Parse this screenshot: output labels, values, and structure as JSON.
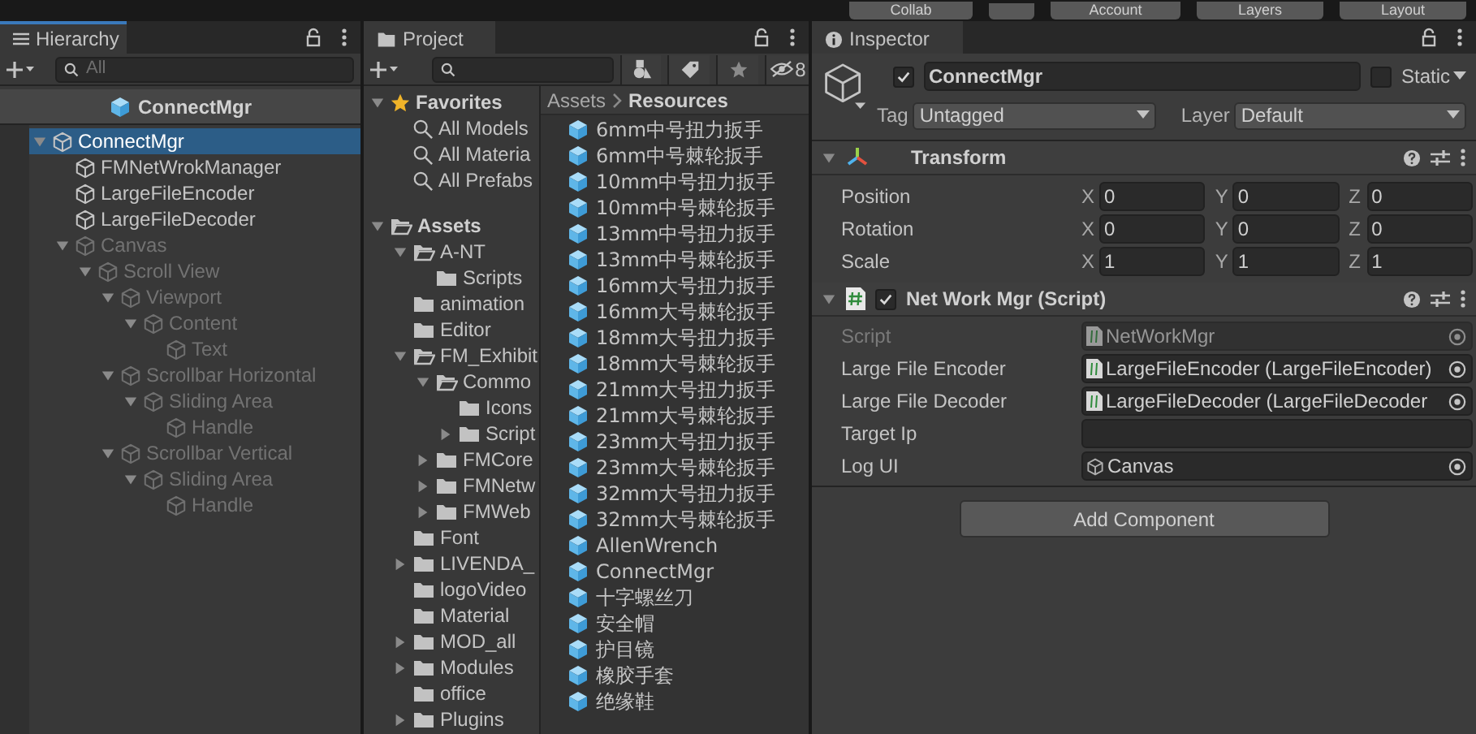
{
  "toolbar": {
    "buttons": [
      "Collab",
      "Account",
      "Layers",
      "Layout"
    ]
  },
  "hierarchy": {
    "tab": {
      "title": "Hierarchy",
      "focused": true
    },
    "search": {
      "placeholder": "All"
    },
    "scene_header": "ConnectMgr",
    "tree": [
      {
        "label": "ConnectMgr",
        "selected": true,
        "active": true,
        "expanded": true,
        "children": [
          {
            "label": "FMNetWrokManager",
            "selected": false,
            "active": true
          },
          {
            "label": "LargeFileEncoder",
            "selected": false,
            "active": true
          },
          {
            "label": "LargeFileDecoder",
            "selected": false,
            "active": true
          },
          {
            "label": "Canvas",
            "selected": false,
            "active": false,
            "expanded": true,
            "children": [
              {
                "label": "Scroll View",
                "selected": false,
                "active": false,
                "expanded": true,
                "children": [
                  {
                    "label": "Viewport",
                    "selected": false,
                    "active": false,
                    "expanded": true,
                    "children": [
                      {
                        "label": "Content",
                        "selected": false,
                        "active": false,
                        "expanded": true,
                        "children": [
                          {
                            "label": "Text",
                            "selected": false,
                            "active": false
                          }
                        ]
                      }
                    ]
                  },
                  {
                    "label": "Scrollbar Horizontal",
                    "selected": false,
                    "active": false,
                    "expanded": true,
                    "children": [
                      {
                        "label": "Sliding Area",
                        "selected": false,
                        "active": false,
                        "expanded": true,
                        "children": [
                          {
                            "label": "Handle",
                            "selected": false,
                            "active": false
                          }
                        ]
                      }
                    ]
                  },
                  {
                    "label": "Scrollbar Vertical",
                    "selected": false,
                    "active": false,
                    "expanded": true,
                    "children": [
                      {
                        "label": "Sliding Area",
                        "selected": false,
                        "active": false,
                        "expanded": true,
                        "children": [
                          {
                            "label": "Handle",
                            "selected": false,
                            "active": false
                          }
                        ]
                      }
                    ]
                  }
                ]
              }
            ]
          }
        ]
      }
    ]
  },
  "project": {
    "tab": {
      "title": "Project",
      "focused": false
    },
    "hidden_count": "8",
    "favorites": {
      "label": "Favorites",
      "expanded": true,
      "items": [
        "All Models",
        "All Materia",
        "All Prefabs"
      ]
    },
    "assets": {
      "label": "Assets",
      "expanded": true,
      "children": [
        {
          "label": "A-NT",
          "expanded": true,
          "children": [
            {
              "label": "Scripts"
            }
          ]
        },
        {
          "label": "animation"
        },
        {
          "label": "Editor"
        },
        {
          "label": "FM_Exhibit",
          "expanded": true,
          "children": [
            {
              "label": "Commo",
              "expanded": true,
              "children": [
                {
                  "label": "Icons"
                },
                {
                  "label": "Script",
                  "expanded": false
                }
              ]
            },
            {
              "label": "FMCore",
              "expanded": false
            },
            {
              "label": "FMNetw",
              "expanded": false
            },
            {
              "label": "FMWeb",
              "expanded": false
            }
          ]
        },
        {
          "label": "Font"
        },
        {
          "label": "LIVENDA_",
          "expanded": false
        },
        {
          "label": "logoVideo"
        },
        {
          "label": "Material"
        },
        {
          "label": "MOD_all",
          "expanded": false
        },
        {
          "label": "Modules",
          "expanded": false
        },
        {
          "label": "office"
        },
        {
          "label": "Plugins",
          "expanded": false
        }
      ]
    },
    "breadcrumb": [
      "Assets",
      "Resources"
    ],
    "files": [
      "6mm中号扭力扳手",
      "6mm中号棘轮扳手",
      "10mm中号扭力扳手",
      "10mm中号棘轮扳手",
      "13mm中号扭力扳手",
      "13mm中号棘轮扳手",
      "16mm大号扭力扳手",
      "16mm大号棘轮扳手",
      "18mm大号扭力扳手",
      "18mm大号棘轮扳手",
      "21mm大号扭力扳手",
      "21mm大号棘轮扳手",
      "23mm大号扭力扳手",
      "23mm大号棘轮扳手",
      "32mm大号扭力扳手",
      "32mm大号棘轮扳手",
      "AllenWrench",
      "ConnectMgr",
      "十字螺丝刀",
      "安全帽",
      "护目镜",
      "橡胶手套",
      "绝缘鞋"
    ]
  },
  "inspector": {
    "tab": {
      "title": "Inspector",
      "focused": false
    },
    "object": {
      "enabled": true,
      "name": "ConnectMgr",
      "static": false,
      "static_label": "Static",
      "tag_label": "Tag",
      "tag": "Untagged",
      "layer_label": "Layer",
      "layer": "Default"
    },
    "transform": {
      "title": "Transform",
      "expanded": true,
      "rows": [
        {
          "label": "Position",
          "values": [
            {
              "axis": "X",
              "value": "0"
            },
            {
              "axis": "Y",
              "value": "0"
            },
            {
              "axis": "Z",
              "value": "0"
            }
          ]
        },
        {
          "label": "Rotation",
          "values": [
            {
              "axis": "X",
              "value": "0"
            },
            {
              "axis": "Y",
              "value": "0"
            },
            {
              "axis": "Z",
              "value": "0"
            }
          ]
        },
        {
          "label": "Scale",
          "values": [
            {
              "axis": "X",
              "value": "1"
            },
            {
              "axis": "Y",
              "value": "1"
            },
            {
              "axis": "Z",
              "value": "1"
            }
          ]
        }
      ]
    },
    "script_component": {
      "title": "Net Work Mgr (Script)",
      "expanded": true,
      "enabled": true,
      "fields": [
        {
          "label": "Script",
          "kind": "script",
          "value": "NetWorkMgr",
          "disabled": true
        },
        {
          "label": "Large File Encoder",
          "kind": "script",
          "value": "LargeFileEncoder (LargeFileEncoder)",
          "disabled": false
        },
        {
          "label": "Large File Decoder",
          "kind": "script",
          "value": "LargeFileDecoder (LargeFileDecoder",
          "disabled": false
        },
        {
          "label": "Target Ip",
          "kind": "text",
          "disabled": false
        },
        {
          "label": "Log UI",
          "kind": "object",
          "value": "Canvas",
          "disabled": false
        }
      ]
    },
    "add_component": "Add Component"
  }
}
